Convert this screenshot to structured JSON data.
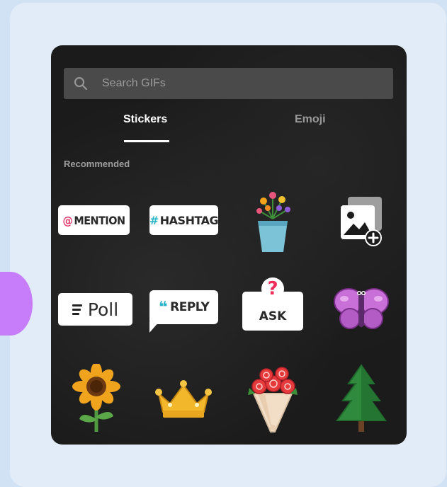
{
  "search": {
    "placeholder": "Search GIFs"
  },
  "tabs": [
    {
      "label": "Stickers",
      "active": true
    },
    {
      "label": "Emoji",
      "active": false
    }
  ],
  "section": {
    "label": "Recommended"
  },
  "stickers": {
    "mention": {
      "prefix": "@",
      "label": "MENTION"
    },
    "hashtag": {
      "prefix": "#",
      "label": "HASHTAG"
    },
    "poll": {
      "label": "Poll"
    },
    "reply": {
      "label": "REPLY"
    },
    "ask": {
      "mark": "?",
      "label": "ASK"
    },
    "icons": [
      "flower-vase-icon",
      "add-photo-icon",
      "butterfly-icon",
      "sunflower-icon",
      "crown-icon",
      "rose-bouquet-icon",
      "pine-tree-icon"
    ]
  },
  "colors": {
    "accent_pink": "#e5376a",
    "accent_teal": "#2bb5c8",
    "panel": "#1b1b1b"
  }
}
